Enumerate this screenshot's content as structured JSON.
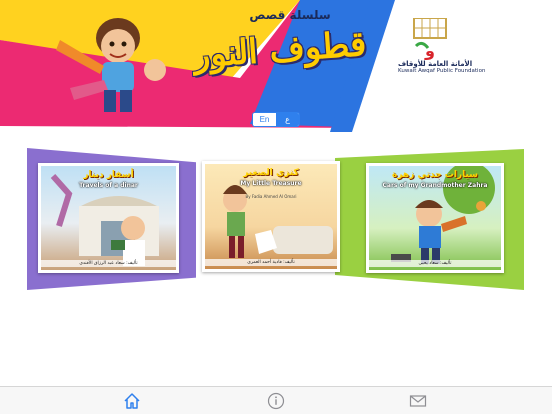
{
  "header": {
    "series_title": "سلسلة قصص",
    "app_title": "قطوف النور",
    "foundation_name_ar": "الأمانة العامة للأوقاف",
    "foundation_name_en": "Kuwait Awqaf Public Foundation"
  },
  "language_toggle": {
    "options": [
      {
        "label": "En",
        "selected": false
      },
      {
        "label": "ع",
        "selected": true
      }
    ]
  },
  "books": [
    {
      "title_ar": "أسفار دينار",
      "title_en": "Travels of a dinar",
      "author": "تأليف: سعاد عبد الرزاق الأفندي"
    },
    {
      "title_ar": "كنزي الصغير",
      "title_en": "My Little Treasure",
      "by": "By Fadia Ahmed Al Omari",
      "author": "تأليف: فادية أحمد العمري"
    },
    {
      "title_ar": "سيارات جدتي زهرة",
      "title_en": "Cars of my Grandmother Zahra",
      "author": "تأليف: سعاد يحيى"
    }
  ],
  "tabbar": {
    "tabs": [
      {
        "icon": "home-icon",
        "selected": true
      },
      {
        "icon": "info-icon",
        "selected": false
      },
      {
        "icon": "mail-icon",
        "selected": false
      }
    ]
  },
  "colors": {
    "pink": "#ec2a72",
    "yellow": "#ffd21f",
    "blue": "#2c74e0",
    "purple": "#8a6fcf",
    "green": "#9ad041",
    "accent": "#2f80ed"
  }
}
